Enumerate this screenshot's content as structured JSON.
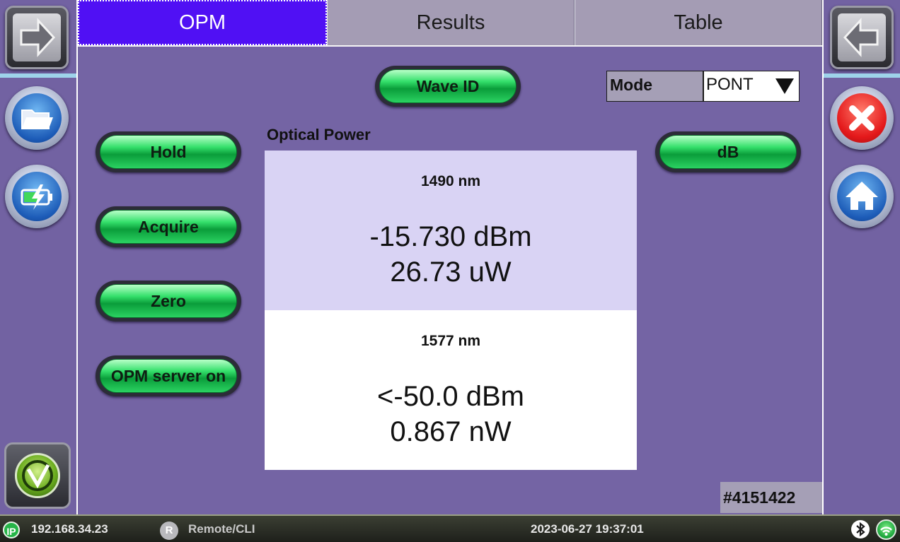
{
  "tabs": [
    "OPM",
    "Results",
    "Table"
  ],
  "buttons": {
    "wave_id": "Wave ID",
    "hold": "Hold",
    "acquire": "Acquire",
    "zero": "Zero",
    "opm_server": "OPM server on",
    "db": "dB"
  },
  "mode": {
    "label": "Mode",
    "value": "PONT"
  },
  "section_title": "Optical Power",
  "measurements": [
    {
      "wavelength": "1490 nm",
      "dbm": "-15.730 dBm",
      "power": "26.73 uW"
    },
    {
      "wavelength": "1577 nm",
      "dbm": "<-50.0 dBm",
      "power": "0.867 nW"
    }
  ],
  "serial": "#4151422",
  "status": {
    "ip_badge": "IP",
    "ip": "192.168.34.23",
    "remote_badge": "R",
    "remote": "Remote/CLI",
    "datetime": "2023-06-27  19:37:01"
  },
  "icons": {
    "left_rail": [
      "forward-arrow-icon",
      "folder-icon",
      "battery-charging-icon",
      "logo-icon"
    ],
    "right_rail": [
      "back-arrow-icon",
      "close-icon",
      "home-icon"
    ],
    "status": [
      "ip-icon",
      "remote-icon",
      "bluetooth-icon",
      "wifi-icon"
    ]
  },
  "colors": {
    "background": "#7464a4",
    "active_tab": "#5010f4",
    "button_green": "#35e06c",
    "reading_top": "#d9d3f4"
  }
}
